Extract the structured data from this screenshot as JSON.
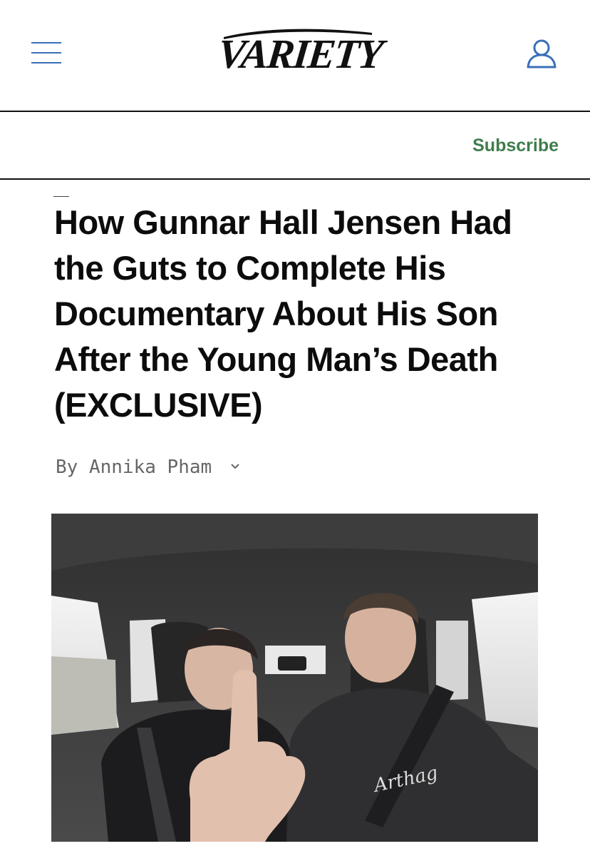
{
  "header": {
    "logo_text": "VARIETY",
    "menu_icon": "hamburger-menu-icon",
    "account_icon": "user-account-icon"
  },
  "subscribe": {
    "label": "Subscribe"
  },
  "article": {
    "headline": "How Gunnar Hall Jensen Had the Guts to Complete His Documentary About His Son After the Young Man’s Death (EXCLUSIVE)",
    "byline_prefix": "By",
    "author": "Annika Pham",
    "byline_icon": "chevron-down-icon"
  },
  "photo": {
    "sweater_text": "Arthag"
  },
  "colors": {
    "accent_blue": "#3a6fb8",
    "subscribe_green": "#3f7d4d",
    "byline_gray": "#666666",
    "text": "#0c0c0c"
  }
}
